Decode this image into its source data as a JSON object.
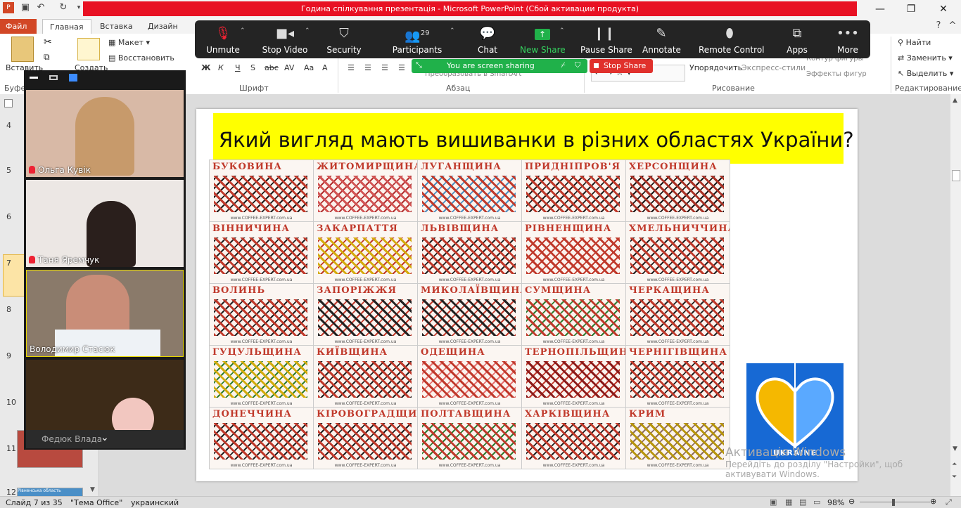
{
  "window": {
    "title": "Година спілкування презентація  -  Microsoft PowerPoint (Сбой активации продукта)",
    "minimize": "—",
    "restore": "❐",
    "close": "✕"
  },
  "tabs": [
    {
      "label": "Файл"
    },
    {
      "label": "Главная"
    },
    {
      "label": "Вставка"
    },
    {
      "label": "Дизайн"
    }
  ],
  "ribbon": {
    "paste": "Вставить",
    "create": "Создать",
    "clipboard_group": "Буфер",
    "layout": "Макет",
    "restore": "Восстановить",
    "font_group": "Шрифт",
    "paragraph_group": "Абзац",
    "smartart": "Преобразовать в SmartArt",
    "arrange": "Упорядочить",
    "quick_styles": "Экспресс-стили",
    "shape_outline": "Контур фигуры",
    "shape_effects": "Эффекты фигур",
    "drawing_group": "Рисование",
    "find": "Найти",
    "replace": "Заменить",
    "select": "Выделить",
    "editing_group": "Редактирование",
    "font_buttons": [
      "Ж",
      "К",
      "Ч",
      "S",
      "abc",
      "AV",
      "Aa",
      "A"
    ]
  },
  "zoom": {
    "buttons": [
      {
        "label": "Unmute",
        "icon": "mic-off-icon"
      },
      {
        "label": "Stop Video",
        "icon": "video-camera-icon"
      },
      {
        "label": "Security",
        "icon": "shield-icon"
      },
      {
        "label": "Participants",
        "icon": "participants-icon",
        "count": "29"
      },
      {
        "label": "Chat",
        "icon": "chat-icon"
      },
      {
        "label": "New Share",
        "icon": "share-arrow-icon"
      },
      {
        "label": "Pause Share",
        "icon": "pause-icon"
      },
      {
        "label": "Annotate",
        "icon": "pencil-icon"
      },
      {
        "label": "Remote Control",
        "icon": "mouse-icon"
      },
      {
        "label": "Apps",
        "icon": "apps-icon"
      },
      {
        "label": "More",
        "icon": "more-icon"
      }
    ],
    "sharing_text": "You are screen sharing",
    "stop_share": "Stop Share",
    "accent_green": "#20b14a",
    "stop_red": "#e0302c"
  },
  "participants": [
    {
      "name": "Ольга Кувік"
    },
    {
      "name": "Таня Яремчук"
    },
    {
      "name": "Володимир Стасюк"
    },
    {
      "name": "Федюк Влада"
    }
  ],
  "thumbnails": {
    "numbers": [
      "4",
      "5",
      "6",
      "7",
      "8",
      "9",
      "10",
      "11",
      "12"
    ],
    "last_caption": "Рівненська область"
  },
  "slide": {
    "title": "Який вигляд мають вишиванки в різних областях України?",
    "site": "www.COFFEE-EXPERT.com.ua",
    "regions": [
      "БУКОВИНА",
      "ЖИТОМИРЩИНА",
      "ЛУГАНЩИНА",
      "ПРИДНІПРОВ'Я",
      "ХЕРСОНЩИНА",
      "ВІННИЧИНА",
      "ЗАКАРПАТТЯ",
      "ЛЬВІВЩИНА",
      "РІВНЕНЩИНА",
      "ХМЕЛЬНИЧЧИНА",
      "ВОЛИНЬ",
      "ЗАПОРІЖЖЯ",
      "МИКОЛАЇВЩИНА",
      "СУМЩИНА",
      "ЧЕРКАЩИНА",
      "ГУЦУЛЬЩИНА",
      "КИЇВЩИНА",
      "ОДЕЩИНА",
      "ТЕРНОПІЛЬЩИНА",
      "ЧЕРНІГІВЩИНА",
      "ДОНЕЧЧИНА",
      "КІРОВОГРАДЩИНА",
      "ПОЛТАВЩИНА",
      "ХАРКІВЩИНА",
      "КРИМ"
    ],
    "logo_text": "UKRAINE"
  },
  "watermark": {
    "line1": "Активація Windows",
    "line2": "Перейдіть до розділу \"Настройки\", щоб",
    "line3": "активувати Windows."
  },
  "status": {
    "slide": "Слайд 7 из 35",
    "theme": "\"Тема Office\"",
    "language": "украинский",
    "zoom": "98%"
  }
}
